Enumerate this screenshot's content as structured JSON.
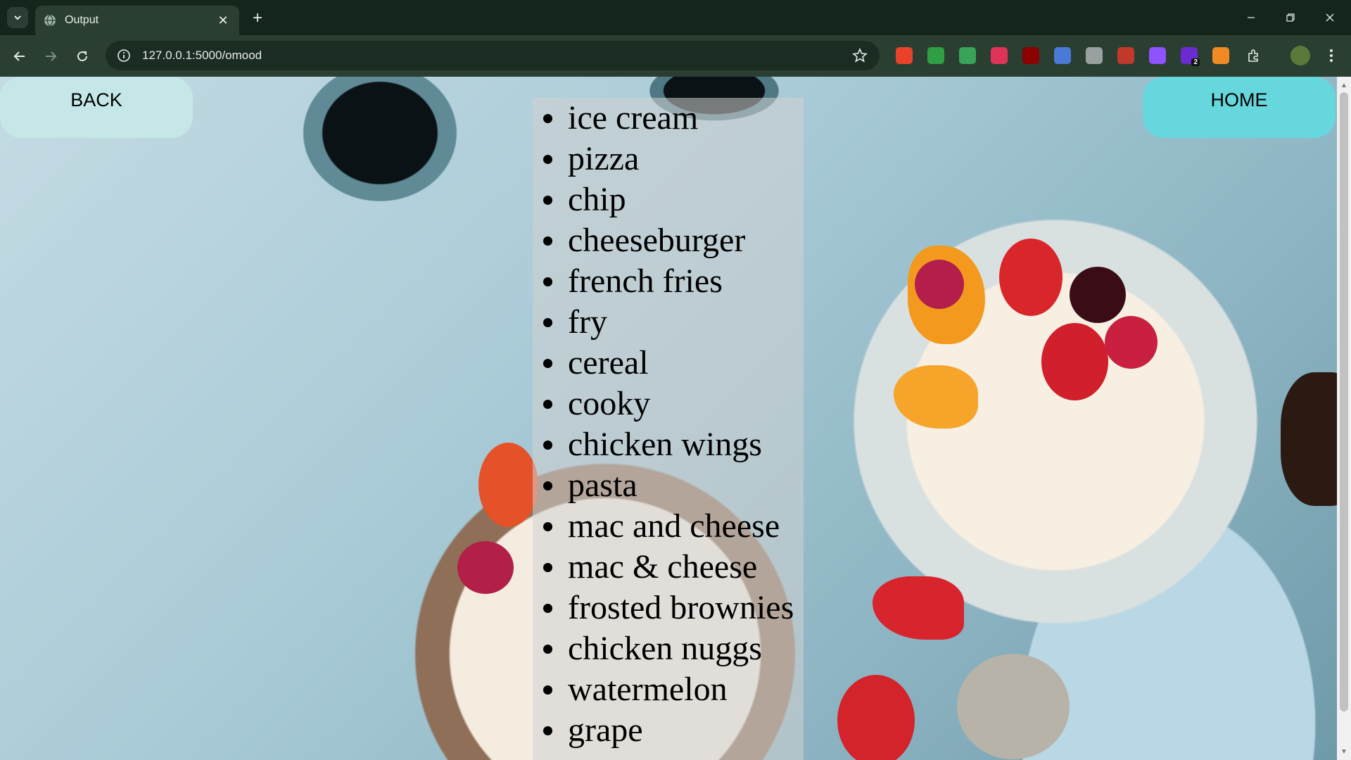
{
  "browser": {
    "tab_title": "Output",
    "url": "127.0.0.1:5000/omood",
    "new_tab_label": "+",
    "tab_close_label": "✕"
  },
  "page": {
    "back_label": "BACK",
    "home_label": "HOME",
    "foods": [
      "ice cream",
      "pizza",
      "chip",
      "cheeseburger",
      "french fries",
      "fry",
      "cereal",
      "cooky",
      "chicken wings",
      "pasta",
      "mac and cheese",
      "mac & cheese",
      "frosted brownies",
      "chicken nuggs",
      "watermelon",
      "grape"
    ]
  },
  "extensions": [
    {
      "name": "ext-red-circle-icon",
      "color": "#e8432a",
      "badge": ""
    },
    {
      "name": "ext-green-lock-icon",
      "color": "#2f9e44",
      "badge": ""
    },
    {
      "name": "ext-mail-icon",
      "color": "#3aa35a",
      "badge": ""
    },
    {
      "name": "ext-pink-icon",
      "color": "#e0335a",
      "badge": ""
    },
    {
      "name": "ext-ublock-icon",
      "color": "#8b0000",
      "badge": ""
    },
    {
      "name": "ext-screen-icon",
      "color": "#4a79d6",
      "badge": ""
    },
    {
      "name": "ext-grey-icon",
      "color": "#9aa0a0",
      "badge": ""
    },
    {
      "name": "ext-shield-icon",
      "color": "#c0392b",
      "badge": ""
    },
    {
      "name": "ext-twitch-icon",
      "color": "#8e52ff",
      "badge": ""
    },
    {
      "name": "ext-purple-p-icon",
      "color": "#6a2bd1",
      "badge": "2"
    },
    {
      "name": "ext-orange-icon",
      "color": "#f08a24",
      "badge": ""
    }
  ]
}
